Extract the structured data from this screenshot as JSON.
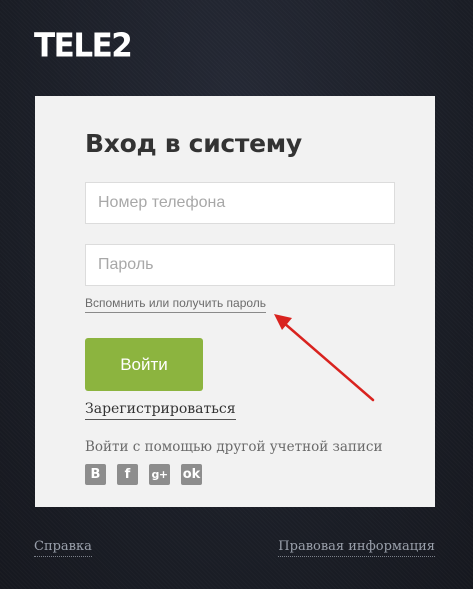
{
  "brand": {
    "logo_text": "TELE2"
  },
  "login": {
    "title": "Вход в систему",
    "phone_placeholder": "Номер телефона",
    "password_placeholder": "Пароль",
    "forgot_link": "Вспомнить или получить пароль",
    "submit_label": "Войти",
    "register_link": "Зарегистрироваться",
    "social_label": "Войти с помощью другой учетной записи",
    "social": [
      {
        "label": "B",
        "icon": "vk-icon"
      },
      {
        "label": "f",
        "icon": "facebook-icon"
      },
      {
        "label": "g+",
        "icon": "google-plus-icon"
      },
      {
        "label": "ok",
        "icon": "odnoklassniki-icon"
      }
    ]
  },
  "footer": {
    "help_link": "Справка",
    "legal_link": "Правовая информация"
  },
  "colors": {
    "background": "#1b1e27",
    "card": "#f2f2f2",
    "button": "#8cb43f",
    "arrow": "#d9231f",
    "social_icon": "#8d8d8d"
  }
}
